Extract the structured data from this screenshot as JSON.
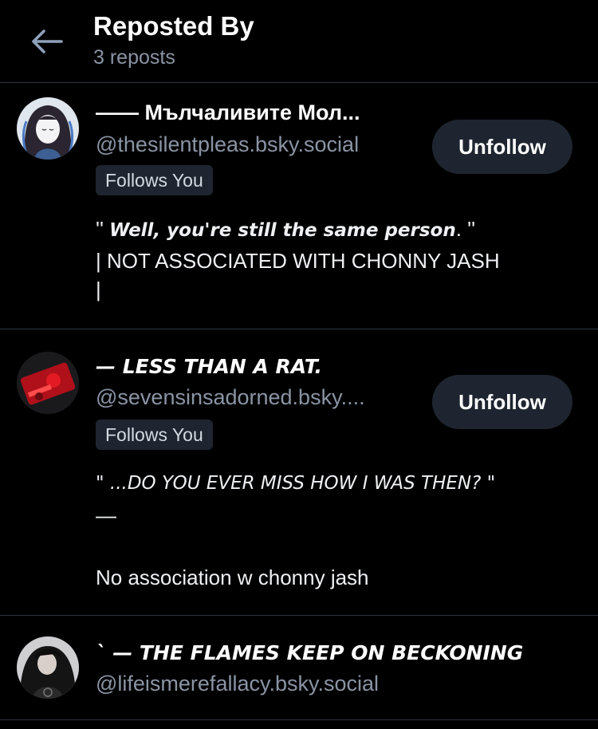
{
  "header": {
    "title": "Reposted By",
    "subtitle": "3 reposts",
    "back_icon": "arrow-left-icon"
  },
  "users": [
    {
      "display_name": "—— Мълчаливите Мол...",
      "handle": "@thesilentpleas.bsky.social",
      "follows_you": "Follows You",
      "button": "Unfollow",
      "bio_pre": "''",
      "bio_quote": "Well, you're still the same person",
      "bio_post": ". ''",
      "bio_line2": "| NOT ASSOCIATED WITH CHONNY JASH",
      "bio_line3": "|"
    },
    {
      "display_name": "— LESS THAN A RAT.",
      "handle": "@sevensinsadorned.bsky....",
      "follows_you": "Follows You",
      "button": "Unfollow",
      "bio_line1": "\" ...DO YOU EVER MISS HOW I WAS THEN? \"",
      "bio_line2": "—",
      "bio_line3": "No association w chonny jash"
    },
    {
      "display_name": "` — THE FLAMES KEEP ON BECKONING",
      "handle": "@lifeismerefallacy.bsky.social"
    }
  ],
  "colors": {
    "background": "#000000",
    "muted_text": "#8a94a4",
    "button_bg": "#1e2530",
    "divider": "#2e3440"
  }
}
